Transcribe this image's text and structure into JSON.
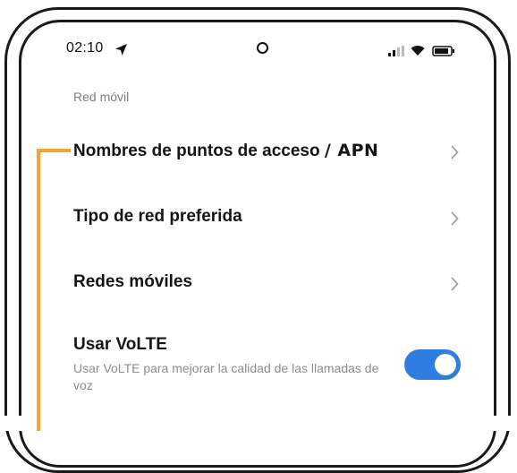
{
  "status_bar": {
    "time": "02:10",
    "icons": [
      "location-arrow-icon",
      "front-camera-icon",
      "signal-icon",
      "wifi-icon",
      "battery-icon"
    ]
  },
  "section": {
    "header": "Red móvil"
  },
  "rows": [
    {
      "title": "Nombres de puntos de acceso",
      "title_suffix": "/ APN",
      "trailing": "chevron-right-icon"
    },
    {
      "title": "Tipo de red preferida",
      "trailing": "chevron-right-icon"
    },
    {
      "title": "Redes móviles",
      "trailing": "chevron-right-icon"
    },
    {
      "title": "Usar VoLTE",
      "subtitle": "Usar VoLTE para mejorar la calidad de las llamadas de voz",
      "trailing": "toggle",
      "toggle_on": true
    }
  ],
  "colors": {
    "accent_toggle": "#2f7de1",
    "callout": "#f5a632",
    "section_header": "#7b7f8a"
  }
}
